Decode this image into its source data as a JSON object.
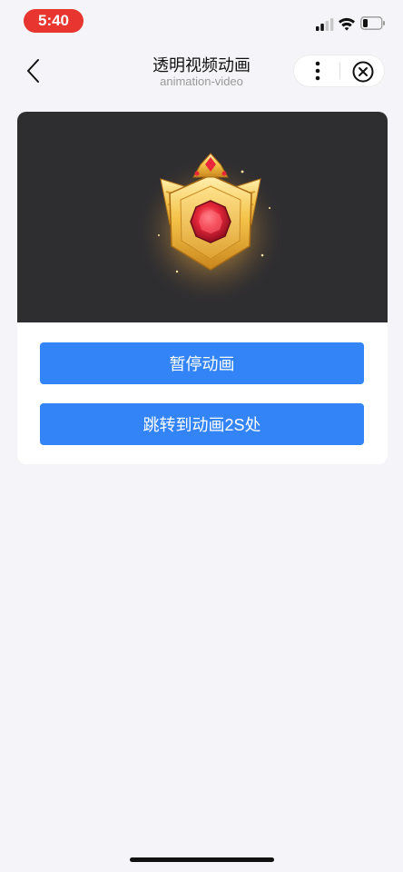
{
  "status_bar": {
    "time": "5:40",
    "time_pill_color": "#e8352f",
    "icons": [
      "signal-icon",
      "wifi-icon",
      "battery-icon"
    ]
  },
  "nav": {
    "title": "透明视频动画",
    "subtitle": "animation-video",
    "icons": [
      "back-icon",
      "more-icon",
      "close-icon"
    ]
  },
  "card": {
    "video_background": "#2e2d30",
    "badge_icon": "gem-badge-icon",
    "buttons": {
      "pause_label": "暂停动画",
      "seek_label": "跳转到动画2S处"
    },
    "button_color": "#3384f6"
  }
}
